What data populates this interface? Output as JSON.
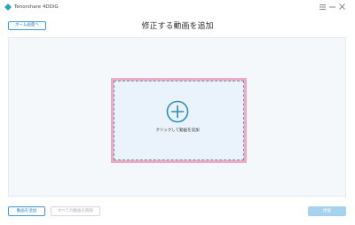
{
  "app": {
    "name": "Tenorshare 4DDiG"
  },
  "header": {
    "home_button": "ホーム画面へ",
    "title": "修正する動画を追加"
  },
  "drop_zone": {
    "label": "クリックして動画を追加",
    "icon": "plus-circle-icon"
  },
  "footer": {
    "add_button": "動画を追加",
    "remove_all_button": "すべての動画を削除",
    "repair_button": "修復"
  },
  "colors": {
    "accent": "#3a9ad9",
    "highlight_border": "#f0a9c2",
    "drop_zone_bg": "#eaf3fb",
    "repair_disabled": "#a6d2f0"
  }
}
